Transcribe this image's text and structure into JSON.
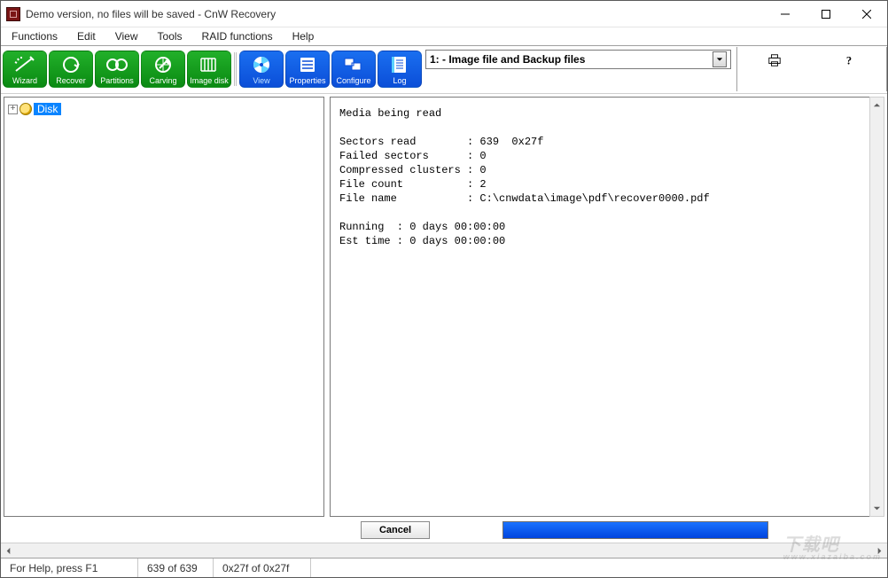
{
  "title": "Demo version, no files will be saved - CnW Recovery",
  "menu": {
    "functions": "Functions",
    "edit": "Edit",
    "view": "View",
    "tools": "Tools",
    "raid": "RAID functions",
    "help": "Help"
  },
  "toolbar": {
    "wizard": "Wizard",
    "recover": "Recover",
    "partitions": "Partitions",
    "carving": "Carving",
    "imagedisk": "Image disk",
    "view": "View",
    "properties": "Properties",
    "configure": "Configure",
    "log": "Log"
  },
  "combo": {
    "selected": "1: - Image file and Backup files"
  },
  "tree": {
    "root_label": "Disk"
  },
  "log": {
    "header": "Media being read",
    "rows": [
      {
        "k": "Sectors read",
        "v": "639  0x27f"
      },
      {
        "k": "Failed sectors",
        "v": "0"
      },
      {
        "k": "Compressed clusters",
        "v": "0"
      },
      {
        "k": "File count",
        "v": "2"
      },
      {
        "k": "File name",
        "v": "C:\\cnwdata\\image\\pdf\\recover0000.pdf"
      }
    ],
    "running": "Running  : 0 days 00:00:00",
    "est": "Est time : 0 days 00:00:00"
  },
  "bottom": {
    "cancel": "Cancel",
    "progress_pct": 100
  },
  "status": {
    "help": "For Help, press F1",
    "sectors": "639 of 639",
    "hex": "0x27f of 0x27f"
  },
  "watermark": {
    "line1": "下载吧",
    "line2": "www.xiazaiba.com"
  }
}
